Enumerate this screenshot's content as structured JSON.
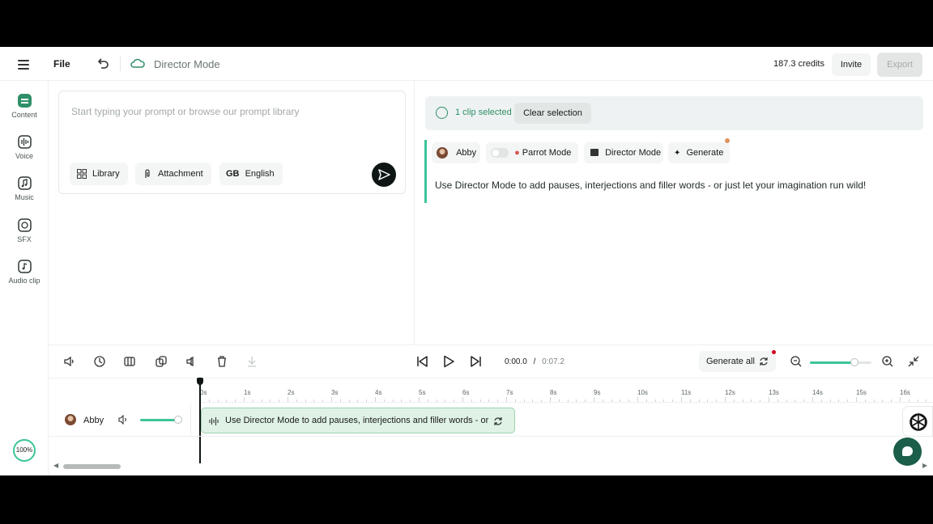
{
  "topbar": {
    "file_label": "File",
    "title": "Director Mode",
    "credits": "187.3 credits",
    "invite_label": "Invite",
    "export_label": "Export"
  },
  "rail": {
    "items": [
      {
        "label": "Content",
        "icon": "content-icon",
        "active": true
      },
      {
        "label": "Voice",
        "icon": "voice-icon",
        "active": false
      },
      {
        "label": "Music",
        "icon": "music-icon",
        "active": false
      },
      {
        "label": "SFX",
        "icon": "sfx-icon",
        "active": false
      },
      {
        "label": "Audio clip",
        "icon": "audio-clip-icon",
        "active": false
      }
    ],
    "zoom_badge": "100%"
  },
  "prompt": {
    "placeholder": "Start typing your prompt or browse our prompt library",
    "library_label": "Library",
    "attachment_label": "Attachment",
    "language_code": "GB",
    "language_label": "English"
  },
  "selection": {
    "text": "1 clip selected",
    "clear_label": "Clear selection"
  },
  "clip_editor": {
    "speaker": "Abby",
    "parrot_label": "Parrot Mode",
    "director_label": "Director Mode",
    "generate_label": "Generate",
    "text": "Use Director Mode to add pauses, interjections and filler words - or just let your imagination run wild!"
  },
  "timeline": {
    "current_time": "0:00.0",
    "separator": "/",
    "duration": "0:07.2",
    "generate_all_label": "Generate all",
    "zoom_level": 0.72,
    "ticks": [
      "0s",
      "1s",
      "2s",
      "3s",
      "4s",
      "5s",
      "6s",
      "7s",
      "8s",
      "9s",
      "10s",
      "11s",
      "12s",
      "13s",
      "14s",
      "15s",
      "16s"
    ],
    "track": {
      "name": "Abby",
      "volume": 0.9,
      "clip_text": "Use Director Mode to add pauses, interjections and filler words - or ju"
    }
  },
  "colors": {
    "accent": "#3cc49a",
    "accent_dark": "#2f8f69",
    "clip_bg": "#dff2e5",
    "alert": "#d0021b"
  }
}
